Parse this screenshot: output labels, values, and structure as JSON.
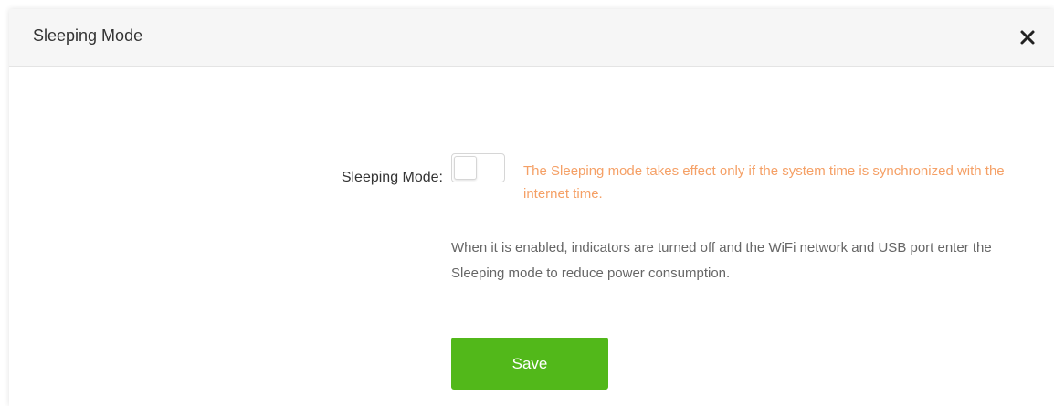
{
  "dialog": {
    "title": "Sleeping Mode",
    "close_icon": "close-icon"
  },
  "sleeping_mode": {
    "label": "Sleeping Mode:",
    "enabled": false,
    "warning": "The Sleeping mode takes effect only if the system time is synchronized with the internet time.",
    "description": "When it is enabled, indicators are turned off and the WiFi network and USB port enter the Sleeping mode to reduce power consumption."
  },
  "actions": {
    "save_label": "Save"
  },
  "colors": {
    "accent": "#52b81a",
    "warning": "#f5a066",
    "header_bg": "#f6f6f6"
  }
}
